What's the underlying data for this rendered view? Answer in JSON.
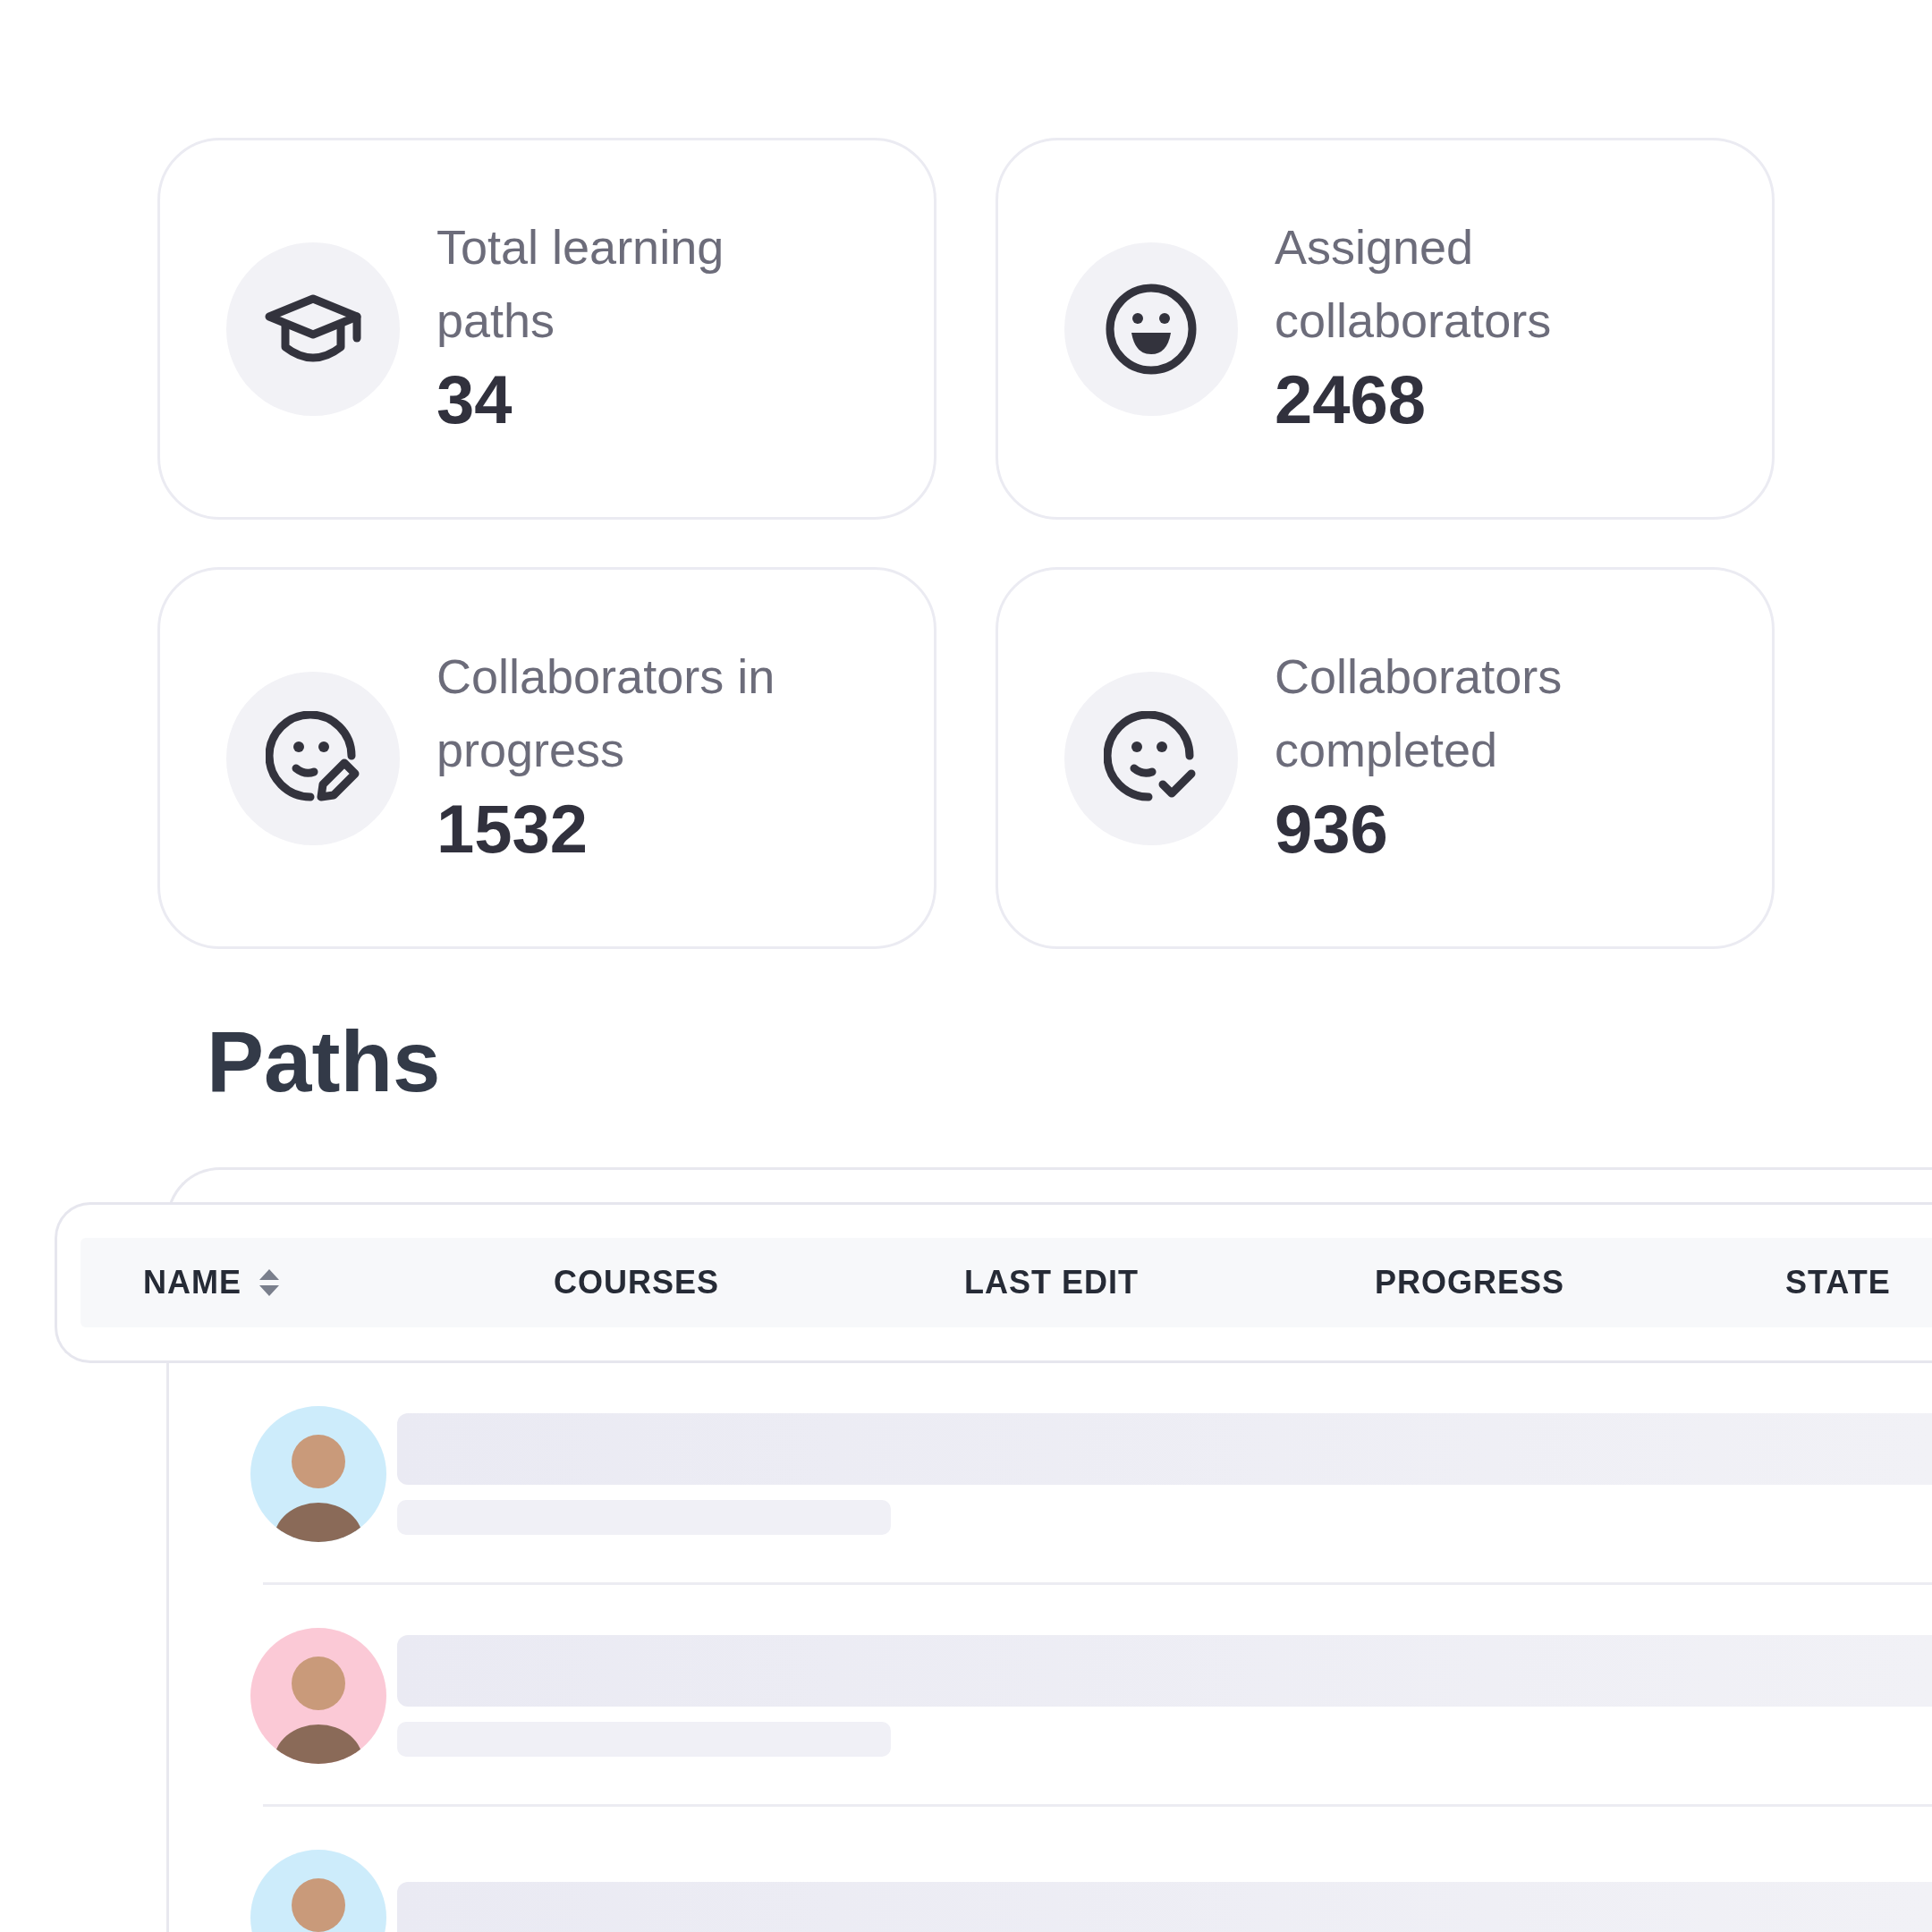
{
  "stats": [
    {
      "kind": "paths",
      "label": "Total learning paths",
      "value": "34"
    },
    {
      "kind": "assigned",
      "label": "Assigned collaborators",
      "value": "2468"
    },
    {
      "kind": "progress",
      "label": "Collaborators in progress",
      "value": "1532"
    },
    {
      "kind": "completed",
      "label": "Collaborators completed",
      "value": "936"
    }
  ],
  "section_title": "Paths",
  "table": {
    "columns": [
      {
        "label": "NAME",
        "sortable": true
      },
      {
        "label": "COURSES",
        "sortable": false
      },
      {
        "label": "LAST EDIT",
        "sortable": false
      },
      {
        "label": "PROGRESS",
        "sortable": false
      },
      {
        "label": "STATE",
        "sortable": false
      }
    ],
    "rows": [
      {
        "color": "#cdecfb"
      },
      {
        "color": "#fbc9d6"
      },
      {
        "color": "#cdecfb"
      }
    ]
  }
}
